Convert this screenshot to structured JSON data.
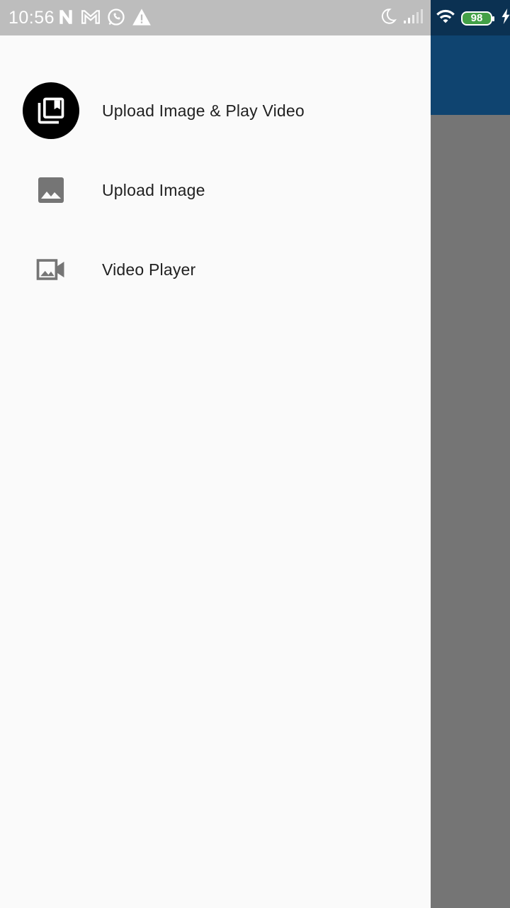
{
  "status_bar": {
    "time": "10:56",
    "battery_level": "98",
    "icons_left": [
      "n-notification-icon",
      "gmail-icon",
      "whatsapp-icon",
      "warning-icon"
    ],
    "icons_right": [
      "moon-icon",
      "signal-icon",
      "wifi-icon",
      "battery-icon",
      "charging-icon"
    ]
  },
  "colors": {
    "app_bar": "#0f4470",
    "scrim": "#757575",
    "drawer_bg": "#fafafa",
    "status_bar_left": "#bdbdbd",
    "battery_fill": "#43a047",
    "text_primary": "#212121",
    "icon_grey": "#757575"
  },
  "drawer": {
    "items": [
      {
        "label": "Upload Image & Play Video",
        "icon": "collections-bookmark-icon"
      },
      {
        "label": "Upload Image",
        "icon": "image-icon"
      },
      {
        "label": "Video Player",
        "icon": "video-image-icon"
      }
    ]
  }
}
